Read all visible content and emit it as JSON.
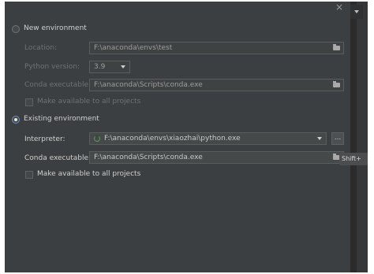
{
  "close_icon": "×",
  "new_environment": {
    "radio_label": "New environment",
    "location_label": "Location:",
    "location_value": "F:\\anaconda\\envs\\test",
    "python_version_label": "Python version:",
    "python_version_value": "3.9",
    "conda_executable_label": "Conda executable:",
    "conda_executable_value": "F:\\anaconda\\Scripts\\conda.exe",
    "make_available_label": "Make available to all projects"
  },
  "existing_environment": {
    "radio_label": "Existing environment",
    "interpreter_label": "Interpreter:",
    "interpreter_value": "F:\\anaconda\\envs\\xiaozhai\\python.exe",
    "browse_button_label": "...",
    "conda_executable_label": "Conda executable:",
    "conda_executable_value": "F:\\anaconda\\Scripts\\conda.exe",
    "make_available_label": "Make available to all projects"
  },
  "tooltip": "Shift+",
  "icons": {
    "folder": "folder-icon",
    "spinner": "loading-spinner-icon",
    "dropdown": "chevron-down-icon",
    "close": "close-icon"
  },
  "colors": {
    "dialog_background": "#3c3f41",
    "field_background": "#45494a",
    "radio_selected_border": "#6f8fbf",
    "spinner": "#5a9e4d"
  }
}
